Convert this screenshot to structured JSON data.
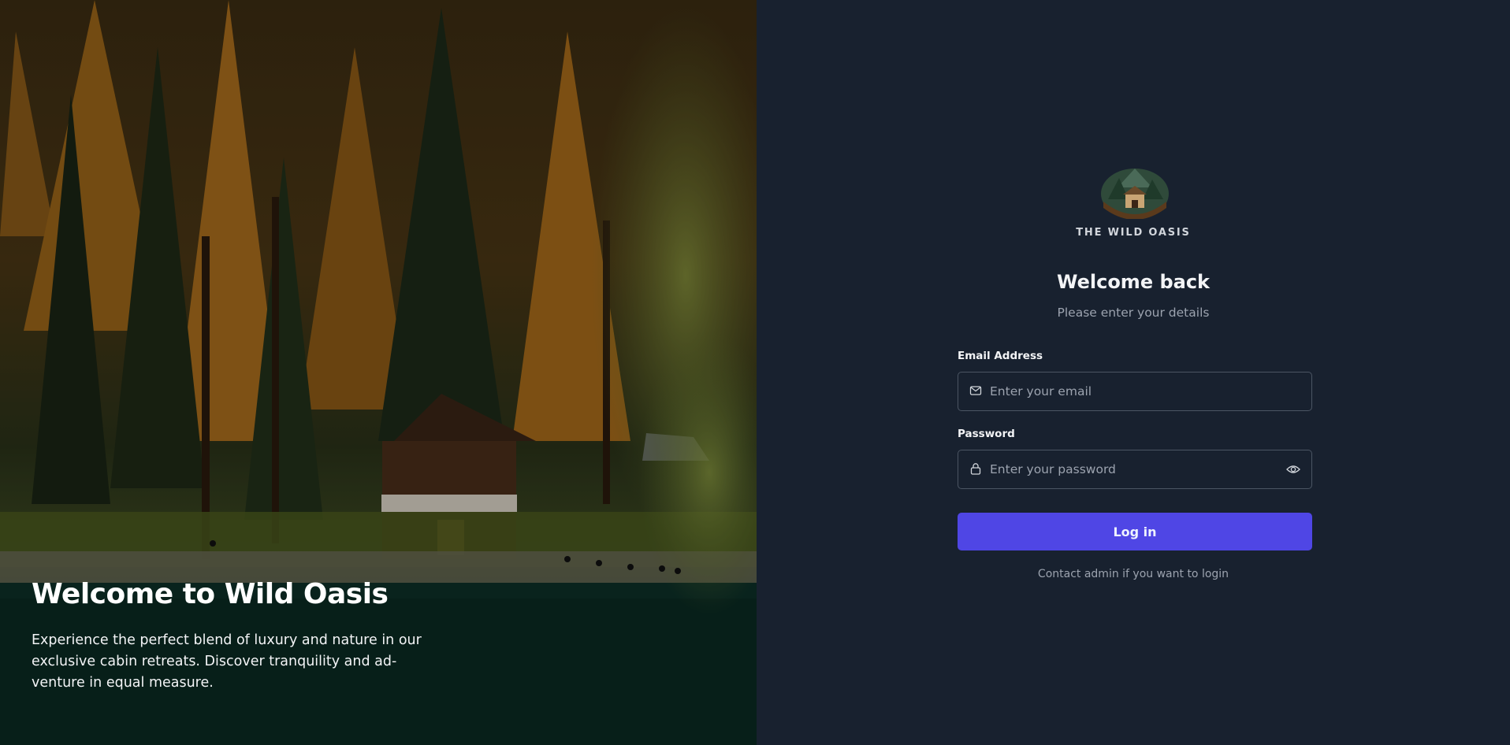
{
  "hero": {
    "headline": "Welcome to Wild Oasis",
    "description": "Experience the perfect blend of luxury and nature in our exclusive cabin retreats. Discover tranquility and ad-venture in equal measure."
  },
  "brand": {
    "name": "THE WILD OASIS"
  },
  "login": {
    "title": "Welcome back",
    "subtitle": "Please enter your details",
    "email": {
      "label": "Email Address",
      "placeholder": "Enter your email",
      "value": ""
    },
    "password": {
      "label": "Password",
      "placeholder": "Enter your password",
      "value": ""
    },
    "submit_label": "Log in",
    "contact_note": "Contact admin if you want to login"
  },
  "colors": {
    "panel_bg": "#18212f",
    "accent": "#4f46e5",
    "text": "#f3f4f6",
    "muted": "#9ca3af",
    "border": "#4b5563"
  },
  "icons": {
    "email": "mail-icon",
    "password": "lock-icon",
    "toggle": "eye-icon",
    "logo": "cabin-logo"
  }
}
